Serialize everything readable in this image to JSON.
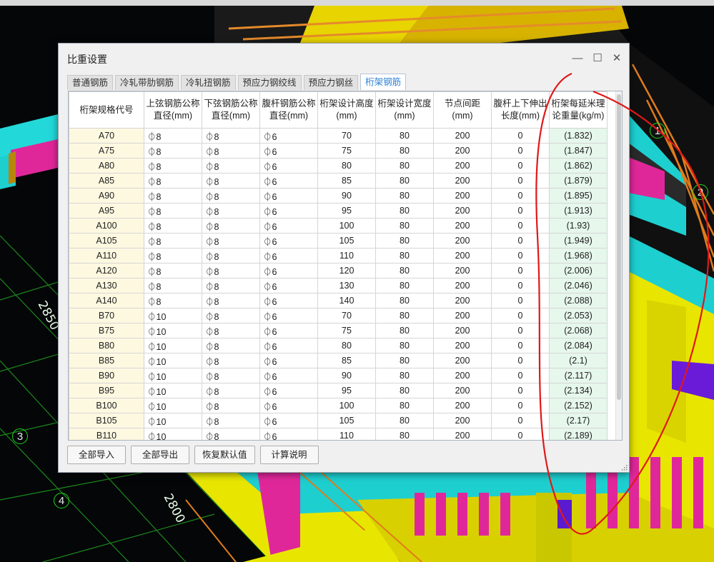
{
  "dialog": {
    "title": "比重设置",
    "minimize_icon": "minimize-icon",
    "maximize_icon": "maximize-icon",
    "close_icon": "close-icon",
    "minimize_glyph": "—",
    "maximize_glyph": "☐",
    "close_glyph": "✕"
  },
  "tabs": [
    {
      "label": "普通钢筋",
      "active": false
    },
    {
      "label": "冷轧带肋钢筋",
      "active": false
    },
    {
      "label": "冷轧扭钢筋",
      "active": false
    },
    {
      "label": "预应力钢绞线",
      "active": false
    },
    {
      "label": "预应力钢丝",
      "active": false
    },
    {
      "label": "桁架钢筋",
      "active": true
    }
  ],
  "table": {
    "headers": [
      [
        "桁架规格代号"
      ],
      [
        "上弦钢筋公称",
        "直径(mm)"
      ],
      [
        "下弦钢筋公称",
        "直径(mm)"
      ],
      [
        "腹杆钢筋公称",
        "直径(mm)"
      ],
      [
        "桁架设计高度",
        "(mm)"
      ],
      [
        "桁架设计宽度",
        "(mm)"
      ],
      [
        "节点间距(mm)"
      ],
      [
        "腹杆上下伸出",
        "长度(mm)"
      ],
      [
        "桁架每延米理",
        "论重量(kg/m)"
      ]
    ],
    "rows": [
      [
        "A70",
        "⏀8",
        "⏀8",
        "⏀6",
        "70",
        "80",
        "200",
        "0",
        "(1.832)"
      ],
      [
        "A75",
        "⏀8",
        "⏀8",
        "⏀6",
        "75",
        "80",
        "200",
        "0",
        "(1.847)"
      ],
      [
        "A80",
        "⏀8",
        "⏀8",
        "⏀6",
        "80",
        "80",
        "200",
        "0",
        "(1.862)"
      ],
      [
        "A85",
        "⏀8",
        "⏀8",
        "⏀6",
        "85",
        "80",
        "200",
        "0",
        "(1.879)"
      ],
      [
        "A90",
        "⏀8",
        "⏀8",
        "⏀6",
        "90",
        "80",
        "200",
        "0",
        "(1.895)"
      ],
      [
        "A95",
        "⏀8",
        "⏀8",
        "⏀6",
        "95",
        "80",
        "200",
        "0",
        "(1.913)"
      ],
      [
        "A100",
        "⏀8",
        "⏀8",
        "⏀6",
        "100",
        "80",
        "200",
        "0",
        "(1.93)"
      ],
      [
        "A105",
        "⏀8",
        "⏀8",
        "⏀6",
        "105",
        "80",
        "200",
        "0",
        "(1.949)"
      ],
      [
        "A110",
        "⏀8",
        "⏀8",
        "⏀6",
        "110",
        "80",
        "200",
        "0",
        "(1.968)"
      ],
      [
        "A120",
        "⏀8",
        "⏀8",
        "⏀6",
        "120",
        "80",
        "200",
        "0",
        "(2.006)"
      ],
      [
        "A130",
        "⏀8",
        "⏀8",
        "⏀6",
        "130",
        "80",
        "200",
        "0",
        "(2.046)"
      ],
      [
        "A140",
        "⏀8",
        "⏀8",
        "⏀6",
        "140",
        "80",
        "200",
        "0",
        "(2.088)"
      ],
      [
        "B70",
        "⏀10",
        "⏀8",
        "⏀6",
        "70",
        "80",
        "200",
        "0",
        "(2.053)"
      ],
      [
        "B75",
        "⏀10",
        "⏀8",
        "⏀6",
        "75",
        "80",
        "200",
        "0",
        "(2.068)"
      ],
      [
        "B80",
        "⏀10",
        "⏀8",
        "⏀6",
        "80",
        "80",
        "200",
        "0",
        "(2.084)"
      ],
      [
        "B85",
        "⏀10",
        "⏀8",
        "⏀6",
        "85",
        "80",
        "200",
        "0",
        "(2.1)"
      ],
      [
        "B90",
        "⏀10",
        "⏀8",
        "⏀6",
        "90",
        "80",
        "200",
        "0",
        "(2.117)"
      ],
      [
        "B95",
        "⏀10",
        "⏀8",
        "⏀6",
        "95",
        "80",
        "200",
        "0",
        "(2.134)"
      ],
      [
        "B100",
        "⏀10",
        "⏀8",
        "⏀6",
        "100",
        "80",
        "200",
        "0",
        "(2.152)"
      ],
      [
        "B105",
        "⏀10",
        "⏀8",
        "⏀6",
        "105",
        "80",
        "200",
        "0",
        "(2.17)"
      ],
      [
        "B110",
        "⏀10",
        "⏀8",
        "⏀6",
        "110",
        "80",
        "200",
        "0",
        "(2.189)"
      ]
    ]
  },
  "buttons": {
    "import_all": "全部导入",
    "export_all": "全部导出",
    "restore_default": "恢复默认值",
    "calc_info": "计算说明"
  },
  "background": {
    "dim_2850": "2850",
    "dim_2800": "2800",
    "axis_3": "3",
    "axis_4": "4",
    "axis_2": "2",
    "axis_1": "1"
  },
  "colors": {
    "active_tab_text": "#2a7fd4",
    "code_column_bg": "#fdf8e0",
    "weight_column_bg": "#e6f7ec",
    "annotation_red": "#e01818"
  }
}
